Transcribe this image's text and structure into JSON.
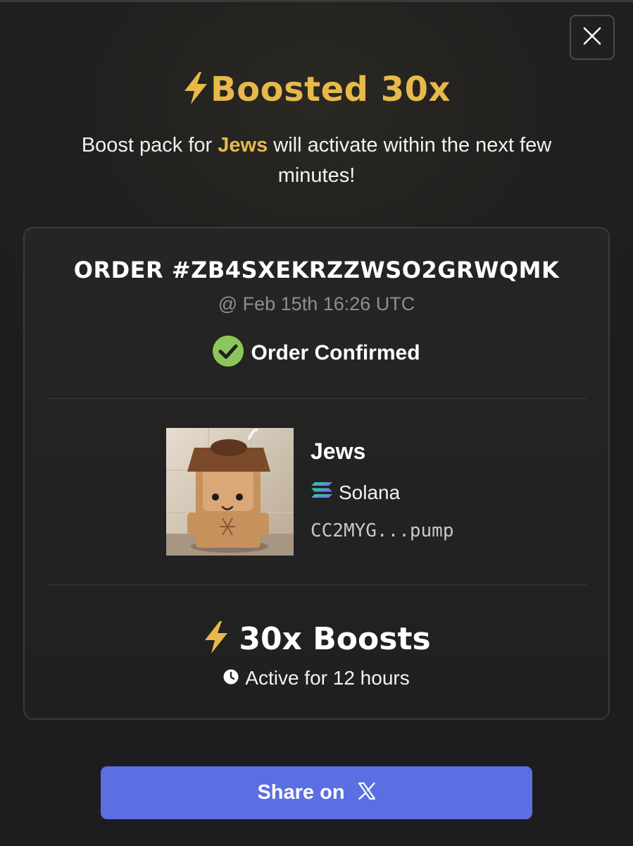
{
  "header": {
    "title": "Boosted 30x",
    "subtitle_before": "Boost pack for ",
    "subtitle_token": "Jews",
    "subtitle_after": " will activate within the next few minutes!"
  },
  "order": {
    "number": "ORDER #ZB4SXEKRZZWSO2GRWQMK",
    "timestamp": "@ Feb 15th 16:26 UTC",
    "status": "Order Confirmed"
  },
  "token": {
    "name": "Jews",
    "chain": "Solana",
    "address": "CC2MYG...pump",
    "image_icon": "token-character-image"
  },
  "boost": {
    "label": "30x Boosts",
    "duration": "Active for 12 hours"
  },
  "actions": {
    "share_label": "Share on"
  },
  "icons": {
    "close": "close-icon",
    "lightning": "lightning-icon",
    "check": "check-circle-icon",
    "chain": "solana-icon",
    "clock": "clock-icon",
    "x_logo": "x-logo-icon"
  },
  "colors": {
    "accent": "#e7b94a",
    "confirm_green": "#8cc65a",
    "button": "#5b6fe2",
    "background": "#1c1c1e"
  }
}
